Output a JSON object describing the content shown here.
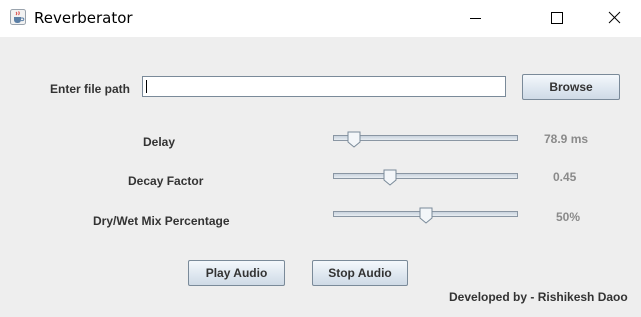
{
  "window": {
    "title": "Reverberator",
    "app_icon": "java-coffee-cup-icon",
    "controls": [
      "minimize-icon",
      "maximize-icon",
      "close-icon"
    ]
  },
  "file": {
    "label": "Enter file path",
    "value": "",
    "browse_label": "Browse"
  },
  "delay": {
    "label": "Delay",
    "value_text": "78.9 ms",
    "slider_fraction": 0.08
  },
  "decay": {
    "label": "Decay Factor",
    "value_text": "0.45",
    "slider_fraction": 0.29
  },
  "mix": {
    "label": "Dry/Wet Mix Percentage",
    "value_text": "50%",
    "slider_fraction": 0.5
  },
  "buttons": {
    "play_label": "Play Audio",
    "stop_label": "Stop Audio"
  },
  "footer": {
    "credit": "Developed by - Rishikesh Daoo"
  },
  "colors": {
    "content_bg": "#eeeeee",
    "titlebar_bg": "#ffffff",
    "value_text": "#8a8a8a",
    "button_border": "#7a8a99"
  }
}
